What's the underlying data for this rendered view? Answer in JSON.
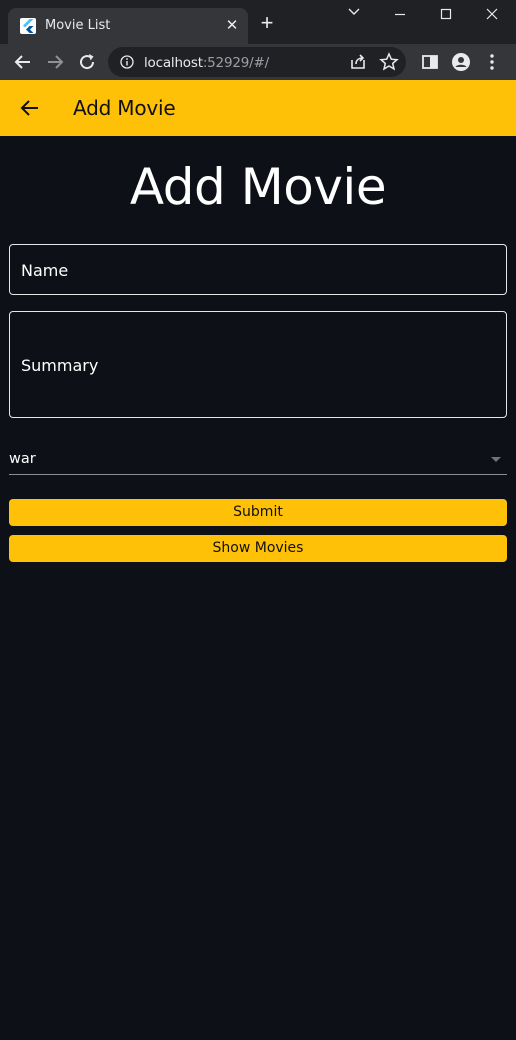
{
  "browser": {
    "tab_title": "Movie List",
    "url_host": "localhost",
    "url_rest": ":52929/#/"
  },
  "app_bar": {
    "title": "Add Movie"
  },
  "page": {
    "heading": "Add Movie"
  },
  "form": {
    "name_label": "Name",
    "summary_label": "Summary",
    "genre_value": "war",
    "submit_label": "Submit",
    "show_movies_label": "Show Movies"
  },
  "colors": {
    "accent": "#ffc107",
    "background": "#0d1017"
  }
}
